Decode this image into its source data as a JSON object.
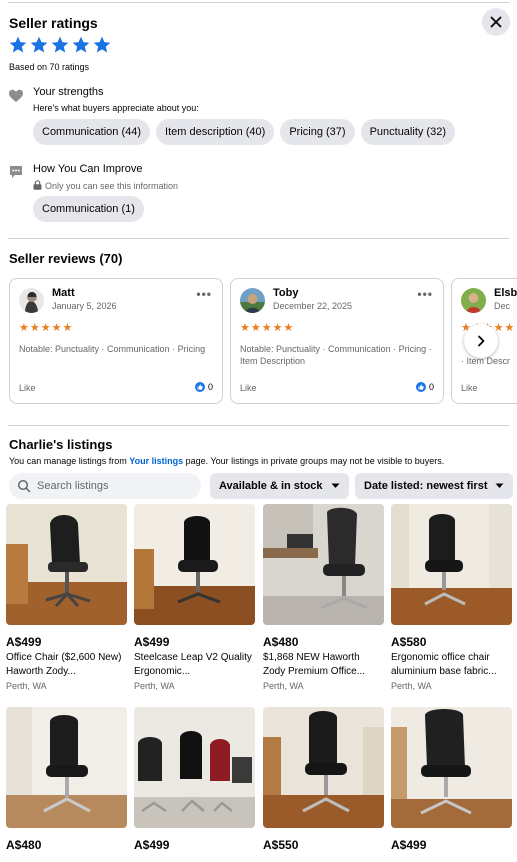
{
  "seller_ratings": {
    "title": "Seller ratings",
    "rating_stars": 5,
    "based_on": "Based on 70 ratings",
    "strengths_title": "Your strengths",
    "strengths_subtitle": "Here's what buyers appreciate about you:",
    "strengths": [
      "Communication (44)",
      "Item description (40)",
      "Pricing (37)",
      "Punctuality (32)"
    ],
    "improve_title": "How You Can Improve",
    "improve_subtitle": "Only you can see this information",
    "improve": [
      "Communication (1)"
    ]
  },
  "reviews": {
    "title": "Seller reviews (70)",
    "items": [
      {
        "name": "Matt",
        "date": "January 5, 2026",
        "tags": "Notable: Punctuality · Communication · Pricing",
        "like": "Like",
        "likes": "0"
      },
      {
        "name": "Toby",
        "date": "December 22, 2025",
        "tags": "Notable: Punctuality · Communication · Pricing · Item Description",
        "like": "Like",
        "likes": "0"
      },
      {
        "name": "Elsb",
        "date": "Dec",
        "tags": "· Item Descr",
        "like": "Like",
        "likes": ""
      }
    ]
  },
  "listings": {
    "title": "Charlie's listings",
    "note_before": "You can manage listings from ",
    "note_link": "Your listings",
    "note_after": " page. Your listings in private groups may not be visible to buyers.",
    "search_placeholder": "Search listings",
    "filter_stock": "Available & in stock",
    "filter_sort": "Date listed: newest first",
    "items": [
      {
        "price": "A$499",
        "title": "Office Chair ($2,600 New) Haworth Zody...",
        "location": "Perth, WA"
      },
      {
        "price": "A$499",
        "title": "Steelcase Leap V2 Quality Ergonomic...",
        "location": "Perth, WA"
      },
      {
        "price": "A$480",
        "title": "$1,868 NEW Haworth Zody Premium Office...",
        "location": "Perth, WA"
      },
      {
        "price": "A$580",
        "title": "Ergonomic office chair aluminium base fabric...",
        "location": "Perth, WA"
      },
      {
        "price": "A$480",
        "title": "",
        "location": ""
      },
      {
        "price": "A$499",
        "title": "",
        "location": ""
      },
      {
        "price": "A$550",
        "title": "",
        "location": ""
      },
      {
        "price": "A$499",
        "title": "",
        "location": ""
      }
    ]
  },
  "colors": {
    "accent": "#1b74e4",
    "star_orange": "#e97d1f",
    "chip_bg": "#e4e6eb"
  },
  "icons": [
    "close-icon",
    "star-icon",
    "heart-icon",
    "chat-icon",
    "lock-icon",
    "more-icon",
    "chevron-right-icon",
    "search-icon",
    "caret-down-icon",
    "thumbs-up-icon"
  ]
}
